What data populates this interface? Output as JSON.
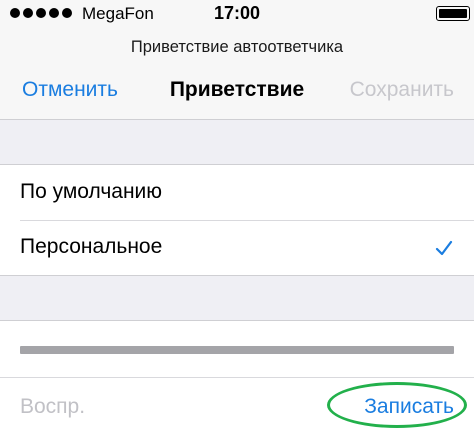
{
  "status_bar": {
    "carrier": "MegaFon",
    "time": "17:00",
    "signal_icon": "signal-dots-icon",
    "battery_icon": "battery-icon"
  },
  "nav": {
    "prompt": "Приветствие автоответчика",
    "cancel_label": "Отменить",
    "title": "Приветствие",
    "save_label": "Сохранить"
  },
  "options": [
    {
      "label": "По умолчанию",
      "selected": false
    },
    {
      "label": "Персональное",
      "selected": true
    }
  ],
  "recording": {
    "progress": 0,
    "play_label": "Воспр.",
    "record_label": "Записать"
  },
  "colors": {
    "accent": "#1a7de0",
    "disabled": "#c7c7cc",
    "highlight": "#22b04b",
    "background": "#efeff4"
  }
}
